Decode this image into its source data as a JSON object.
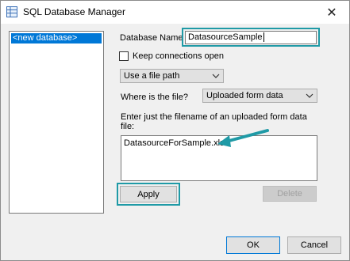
{
  "window": {
    "title": "SQL Database Manager",
    "close_glyph": "✕"
  },
  "list": {
    "items": [
      "<new database>"
    ]
  },
  "form": {
    "database_name_label": "Database Name",
    "database_name_value": "DatasourceSample",
    "keep_connections_label": "Keep connections open",
    "source_type_value": "Use a file path",
    "where_is_file_label": "Where is the file?",
    "where_is_file_value": "Uploaded form data",
    "instruction_line1": "Enter just the filename of an uploaded form data",
    "instruction_line2": "file:",
    "filename_value": "DatasourceForSample.xlsx"
  },
  "buttons": {
    "apply": "Apply",
    "delete": "Delete",
    "ok": "OK",
    "cancel": "Cancel"
  },
  "colors": {
    "highlight": "#1f9aa6",
    "selection": "#0078d7"
  }
}
